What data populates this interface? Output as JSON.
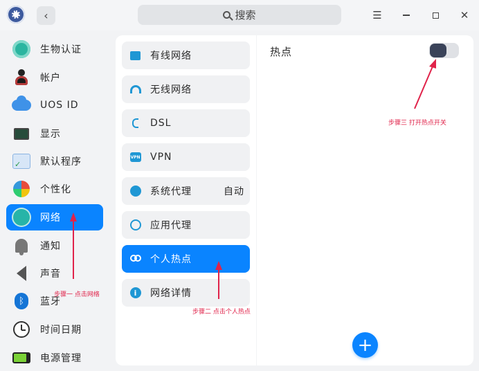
{
  "titlebar": {
    "back_glyph": "‹",
    "search_placeholder": "搜索",
    "menu_glyph": "☰",
    "close_glyph": "✕"
  },
  "sidebar": {
    "items": [
      {
        "label": "生物认证",
        "icon": "fingerprint-icon"
      },
      {
        "label": "帐户",
        "icon": "account-icon"
      },
      {
        "label": "UOS ID",
        "icon": "cloud-icon"
      },
      {
        "label": "显示",
        "icon": "display-icon"
      },
      {
        "label": "默认程序",
        "icon": "default-apps-icon"
      },
      {
        "label": "个性化",
        "icon": "personalization-icon"
      },
      {
        "label": "网络",
        "icon": "network-icon",
        "active": true
      },
      {
        "label": "通知",
        "icon": "bell-icon"
      },
      {
        "label": "声音",
        "icon": "speaker-icon"
      },
      {
        "label": "蓝牙",
        "icon": "bluetooth-icon"
      },
      {
        "label": "时间日期",
        "icon": "clock-icon"
      },
      {
        "label": "电源管理",
        "icon": "battery-icon"
      }
    ]
  },
  "network_menu": {
    "items": [
      {
        "label": "有线网络",
        "icon": "wired-network-icon"
      },
      {
        "label": "无线网络",
        "icon": "wifi-icon"
      },
      {
        "label": "DSL",
        "icon": "dsl-icon"
      },
      {
        "label": "VPN",
        "icon": "vpn-icon",
        "icon_text": "VPN"
      },
      {
        "label": "系统代理",
        "value": "自动",
        "icon": "system-proxy-icon"
      },
      {
        "label": "应用代理",
        "icon": "app-proxy-icon"
      },
      {
        "label": "个人热点",
        "icon": "hotspot-icon",
        "active": true
      },
      {
        "label": "网络详情",
        "icon": "info-icon",
        "icon_text": "i"
      }
    ]
  },
  "hotspot_panel": {
    "title": "热点",
    "toggle_on": false,
    "add_glyph": "+"
  },
  "annotations": {
    "step1": "步骤一 点击网络",
    "step2": "步骤二 点击个人热点",
    "step3": "步骤三 打开热点开关"
  },
  "colors": {
    "accent": "#0a84ff",
    "annotation": "#e0234a",
    "icon_blue": "#1f97d4"
  }
}
